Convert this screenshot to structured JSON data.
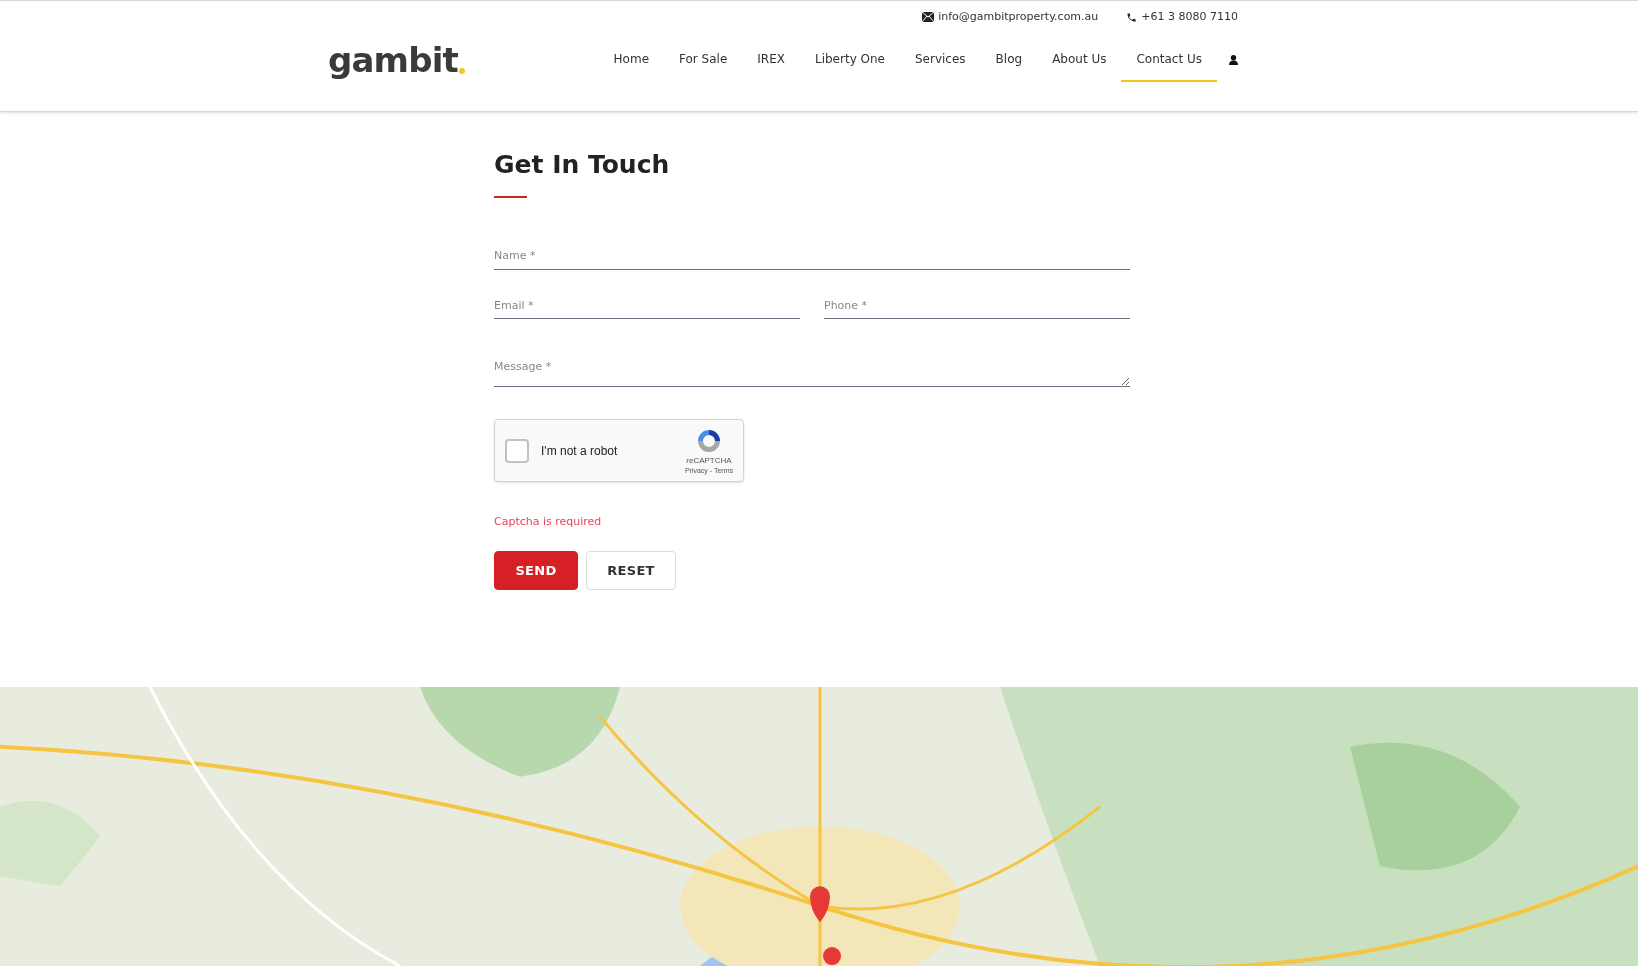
{
  "topbar": {
    "email": "info@gambitproperty.com.au",
    "phone": "+61 3 8080 7110"
  },
  "logo": {
    "text": "gambit"
  },
  "nav": [
    {
      "label": "Home",
      "selected": false
    },
    {
      "label": "For Sale",
      "selected": false
    },
    {
      "label": "IREX",
      "selected": false
    },
    {
      "label": "Liberty One",
      "selected": false
    },
    {
      "label": "Services",
      "selected": false
    },
    {
      "label": "Blog",
      "selected": false
    },
    {
      "label": "About Us",
      "selected": false
    },
    {
      "label": "Contact Us",
      "selected": true
    }
  ],
  "form": {
    "title": "Get In Touch",
    "name": {
      "placeholder": "Name *"
    },
    "email": {
      "placeholder": "Email *"
    },
    "phone": {
      "placeholder": "Phone *"
    },
    "message": {
      "placeholder": "Message *"
    },
    "captcha": {
      "label": "I'm not a robot",
      "checked": false,
      "brand": "reCAPTCHA",
      "links": "Privacy - Terms"
    },
    "error": "Captcha is required",
    "buttons": [
      {
        "label": "SEND",
        "kind": "primary"
      },
      {
        "label": "RESET",
        "kind": "secondary"
      }
    ]
  }
}
